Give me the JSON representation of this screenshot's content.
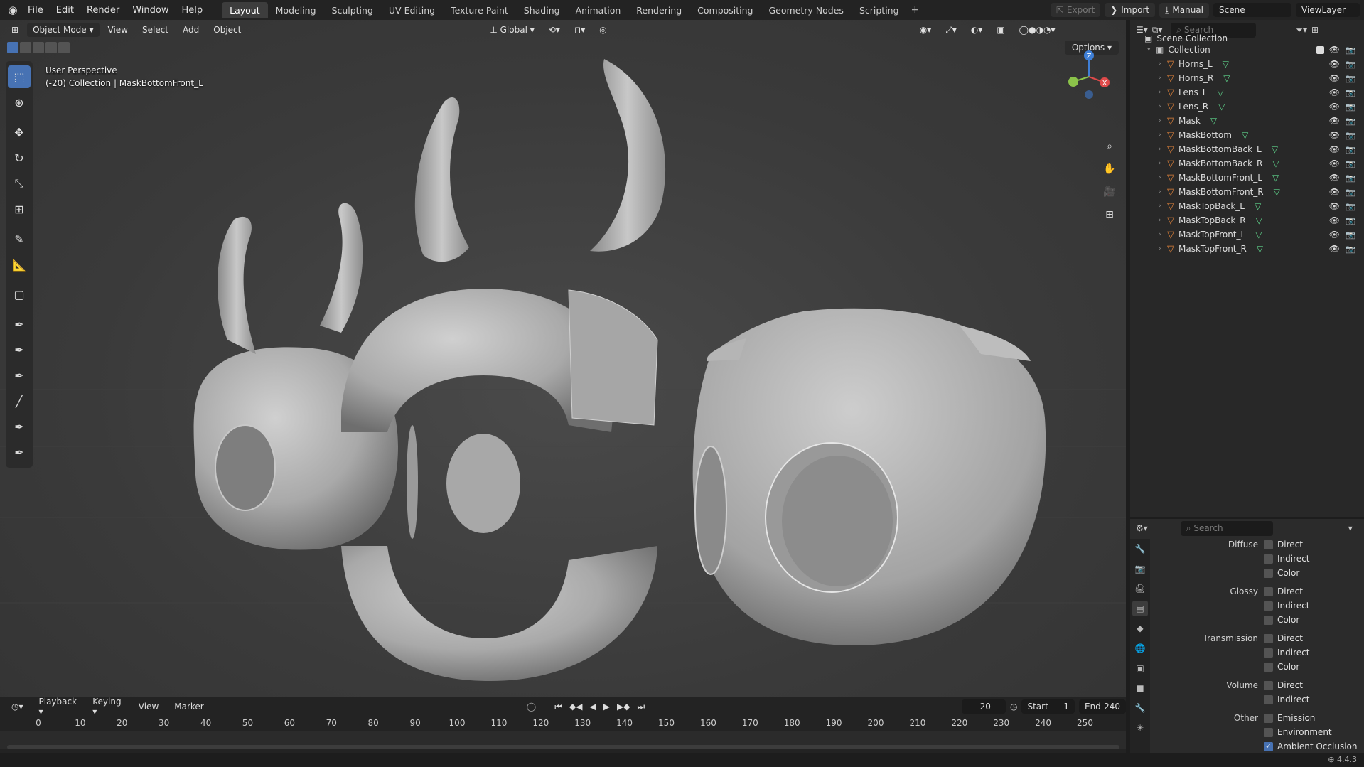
{
  "menu": [
    "File",
    "Edit",
    "Render",
    "Window",
    "Help"
  ],
  "workspaces": [
    "Layout",
    "Modeling",
    "Sculpting",
    "UV Editing",
    "Texture Paint",
    "Shading",
    "Animation",
    "Rendering",
    "Compositing",
    "Geometry Nodes",
    "Scripting"
  ],
  "active_workspace": "Layout",
  "top_right": {
    "export": "Export",
    "import": "Import",
    "manual": "Manual",
    "scene": "Scene",
    "view_layer": "ViewLayer"
  },
  "viewport": {
    "mode": "Object Mode",
    "menus": [
      "View",
      "Select",
      "Add",
      "Object"
    ],
    "orientation": "Global",
    "options": "Options",
    "overlay_line1": "User Perspective",
    "overlay_line2": "(-20) Collection | MaskBottomFront_L",
    "gizmo": {
      "z": "Z",
      "x": "X"
    }
  },
  "outliner": {
    "search_placeholder": "Search",
    "scene_collection": "Scene Collection",
    "collection": "Collection",
    "objects": [
      "Horns_L",
      "Horns_R",
      "Lens_L",
      "Lens_R",
      "Mask",
      "MaskBottom",
      "MaskBottomBack_L",
      "MaskBottomBack_R",
      "MaskBottomFront_L",
      "MaskBottomFront_R",
      "MaskTopBack_L",
      "MaskTopBack_R",
      "MaskTopFront_L",
      "MaskTopFront_R"
    ]
  },
  "properties": {
    "search_placeholder": "Search",
    "rows": [
      {
        "label": "Diffuse",
        "text": "Direct",
        "checked": false
      },
      {
        "label": "",
        "text": "Indirect",
        "checked": false
      },
      {
        "label": "",
        "text": "Color",
        "checked": false
      },
      {
        "label": "Glossy",
        "text": "Direct",
        "checked": false
      },
      {
        "label": "",
        "text": "Indirect",
        "checked": false
      },
      {
        "label": "",
        "text": "Color",
        "checked": false
      },
      {
        "label": "Transmission",
        "text": "Direct",
        "checked": false
      },
      {
        "label": "",
        "text": "Indirect",
        "checked": false
      },
      {
        "label": "",
        "text": "Color",
        "checked": false
      },
      {
        "label": "Volume",
        "text": "Direct",
        "checked": false
      },
      {
        "label": "",
        "text": "Indirect",
        "checked": false
      },
      {
        "label": "Other",
        "text": "Emission",
        "checked": false
      },
      {
        "label": "",
        "text": "Environment",
        "checked": false
      },
      {
        "label": "",
        "text": "Ambient Occlusion",
        "checked": true
      }
    ]
  },
  "timeline": {
    "menus": [
      "Playback",
      "Keying",
      "View",
      "Marker"
    ],
    "current_frame": "-20",
    "start_label": "Start",
    "start": "1",
    "end_label": "End",
    "end": "240",
    "ticks": [
      "0",
      "10",
      "20",
      "30",
      "40",
      "50",
      "60",
      "70",
      "80",
      "90",
      "100",
      "110",
      "120",
      "130",
      "140",
      "150",
      "160",
      "170",
      "180",
      "190",
      "200",
      "210",
      "220",
      "230",
      "240",
      "250"
    ]
  },
  "status": {
    "version": "4.4.3"
  },
  "colors": {
    "accent": "#4772b3",
    "object_icon": "#e3843b",
    "mesh_icon": "#5fd48b",
    "gizmo_x": "#e04a4a",
    "gizmo_y": "#8bc34a",
    "gizmo_z": "#3f7fd6"
  }
}
